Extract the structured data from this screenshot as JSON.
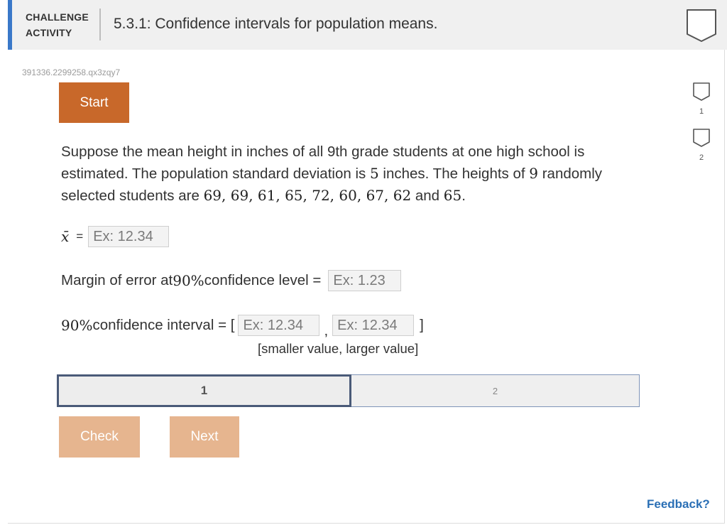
{
  "header": {
    "label_line1": "CHALLENGE",
    "label_line2": "ACTIVITY",
    "title": "5.3.1: Confidence intervals for population means."
  },
  "activity_id": "391336.2299258.qx3zqy7",
  "start_label": "Start",
  "side_levels": [
    {
      "number": "1"
    },
    {
      "number": "2"
    }
  ],
  "problem": {
    "part1": "Suppose the mean height in inches of all 9th grade students at one high school is estimated. The population standard deviation is ",
    "sd": "5",
    "part2": " inches. The heights of ",
    "n": "9",
    "part3": " randomly selected students are ",
    "heights": "69, 69, 61, 65, 72, 60, 67, 62",
    "and_word": " and ",
    "last_height": "65",
    "period": "."
  },
  "xbar": {
    "symbol": "x̄",
    "equals": "=",
    "placeholder": "Ex: 12.34"
  },
  "margin": {
    "label_before": "Margin of error at ",
    "pct": "90%",
    "label_after": " confidence level =",
    "placeholder": "Ex: 1.23"
  },
  "interval": {
    "pct": "90%",
    "label": " confidence interval = [",
    "lower_placeholder": "Ex: 12.34",
    "comma": ",",
    "upper_placeholder": "Ex: 12.34",
    "close": "]",
    "hint": "[smaller value, larger value]"
  },
  "steps": [
    {
      "label": "1",
      "active": true
    },
    {
      "label": "2",
      "active": false
    }
  ],
  "buttons": {
    "check": "Check",
    "next": "Next"
  },
  "feedback": "Feedback?",
  "colors": {
    "accent_blue": "#3a78c9",
    "start_orange": "#c8682a",
    "disabled_orange": "#e6b58f",
    "feedback_blue": "#2a6fb5"
  }
}
